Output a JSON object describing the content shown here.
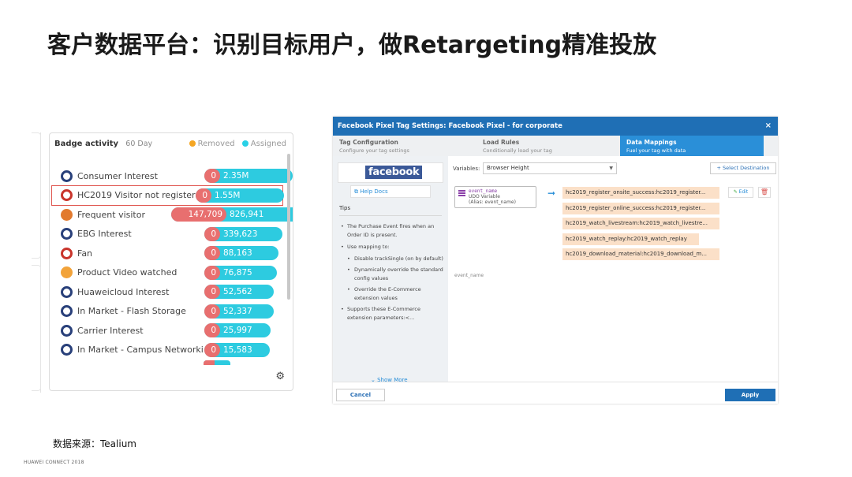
{
  "slide": {
    "title": "客户数据平台：识别目标用户，做Retargeting精准投放",
    "source": "数据来源：Tealium",
    "footer": "HUAWEI CONNECT 2018"
  },
  "badge_panel": {
    "title": "Badge activity",
    "range": "60 Day",
    "legend_removed": "Removed",
    "legend_assigned": "Assigned",
    "colors": {
      "removed": "#e86f6f",
      "assigned": "#2dcbe0",
      "highlight": "#e0554f"
    },
    "rows": [
      {
        "name": "Consumer Interest",
        "removed": "0",
        "assigned": "2.35M",
        "icon": "shield-icon",
        "width": 1.0
      },
      {
        "name": "HC2019 Visitor not register su...",
        "removed": "0",
        "assigned": "1.55M",
        "icon": "shield-red-icon",
        "width": 1.0,
        "highlight": true
      },
      {
        "name": "Frequent visitor",
        "removed": "147,709",
        "assigned": "826,941",
        "icon": "fire-icon",
        "width": 1.0
      },
      {
        "name": "EBG Interest",
        "removed": "0",
        "assigned": "339,623",
        "icon": "shield-icon",
        "width": 0.86
      },
      {
        "name": "Fan",
        "removed": "0",
        "assigned": "88,163",
        "icon": "heart-icon",
        "width": 0.8
      },
      {
        "name": "Product Video watched",
        "removed": "0",
        "assigned": "76,875",
        "icon": "trophy-icon",
        "width": 0.78
      },
      {
        "name": "Huaweicloud Interest",
        "removed": "0",
        "assigned": "52,562",
        "icon": "shield-icon",
        "width": 0.74
      },
      {
        "name": "In Market - Flash Storage",
        "removed": "0",
        "assigned": "52,337",
        "icon": "shield-icon",
        "width": 0.74
      },
      {
        "name": "Carrier Interest",
        "removed": "0",
        "assigned": "25,997",
        "icon": "shield-icon",
        "width": 0.7
      },
      {
        "name": "In Market - Campus Networking",
        "removed": "0",
        "assigned": "15,583",
        "icon": "shield-icon",
        "width": 0.68
      }
    ]
  },
  "fb_dialog": {
    "title": "Facebook Pixel Tag Settings: Facebook Pixel - for corporate",
    "close": "×",
    "tabs": [
      {
        "title": "Tag Configuration",
        "subtitle": "Configure your tag settings",
        "active": false
      },
      {
        "title": "Load Rules",
        "subtitle": "Conditionally load your tag",
        "active": false
      },
      {
        "title": "Data Mappings",
        "subtitle": "Fuel your tag with data",
        "active": true
      }
    ],
    "logo": "facebook",
    "help_docs": "Help Docs",
    "tips_title": "Tips",
    "tips": {
      "purchase": "The Purchase Event fires when an Order ID is present.",
      "use_mapping": "Use mapping to:",
      "sub1": "Disable trackSingle (on by default)",
      "sub2": "Dynamically override the standard config values",
      "sub3": "Override the E-Commerce extension values",
      "supports": "Supports these E-Commerce extension parameters:<..."
    },
    "show_more": "Show More",
    "variables_label": "Variables:",
    "variables_value": "Browser Height",
    "select_destination": "Select Destination",
    "variable": {
      "name": "event_name",
      "type": "UDO Variable",
      "alias": "(Alias: event_name)"
    },
    "variable_caption": "event_name",
    "mappings": [
      "hc2019_register_onsite_success:hc2019_register...",
      "hc2019_register_online_success:hc2019_register...",
      "hc2019_watch_livestream:hc2019_watch_livestre...",
      "hc2019_watch_replay:hc2019_watch_replay",
      "hc2019_download_material:hc2019_download_m..."
    ],
    "edit": "Edit",
    "cancel": "Cancel",
    "apply": "Apply"
  }
}
